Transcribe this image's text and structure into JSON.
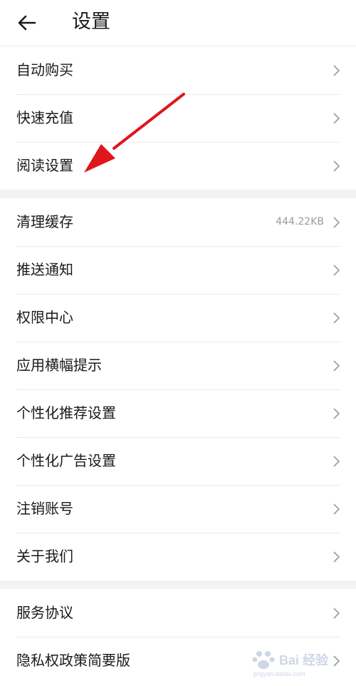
{
  "header": {
    "title": "设置",
    "back_icon": "arrow-left-icon"
  },
  "groups": [
    {
      "items": [
        {
          "label": "自动购买"
        },
        {
          "label": "快速充值"
        },
        {
          "label": "阅读设置"
        }
      ]
    },
    {
      "items": [
        {
          "label": "清理缓存",
          "value": "444.22KB"
        },
        {
          "label": "推送通知"
        },
        {
          "label": "权限中心"
        },
        {
          "label": "应用横幅提示"
        },
        {
          "label": "个性化推荐设置"
        },
        {
          "label": "个性化广告设置"
        },
        {
          "label": "注销账号"
        },
        {
          "label": "关于我们"
        }
      ]
    },
    {
      "items": [
        {
          "label": "服务协议"
        },
        {
          "label": "隐私权政策简要版"
        }
      ]
    }
  ],
  "annotation": {
    "color": "#e0161b"
  },
  "watermark": {
    "text": "Bai 经验",
    "sub": "jingyan.baidu.com"
  }
}
